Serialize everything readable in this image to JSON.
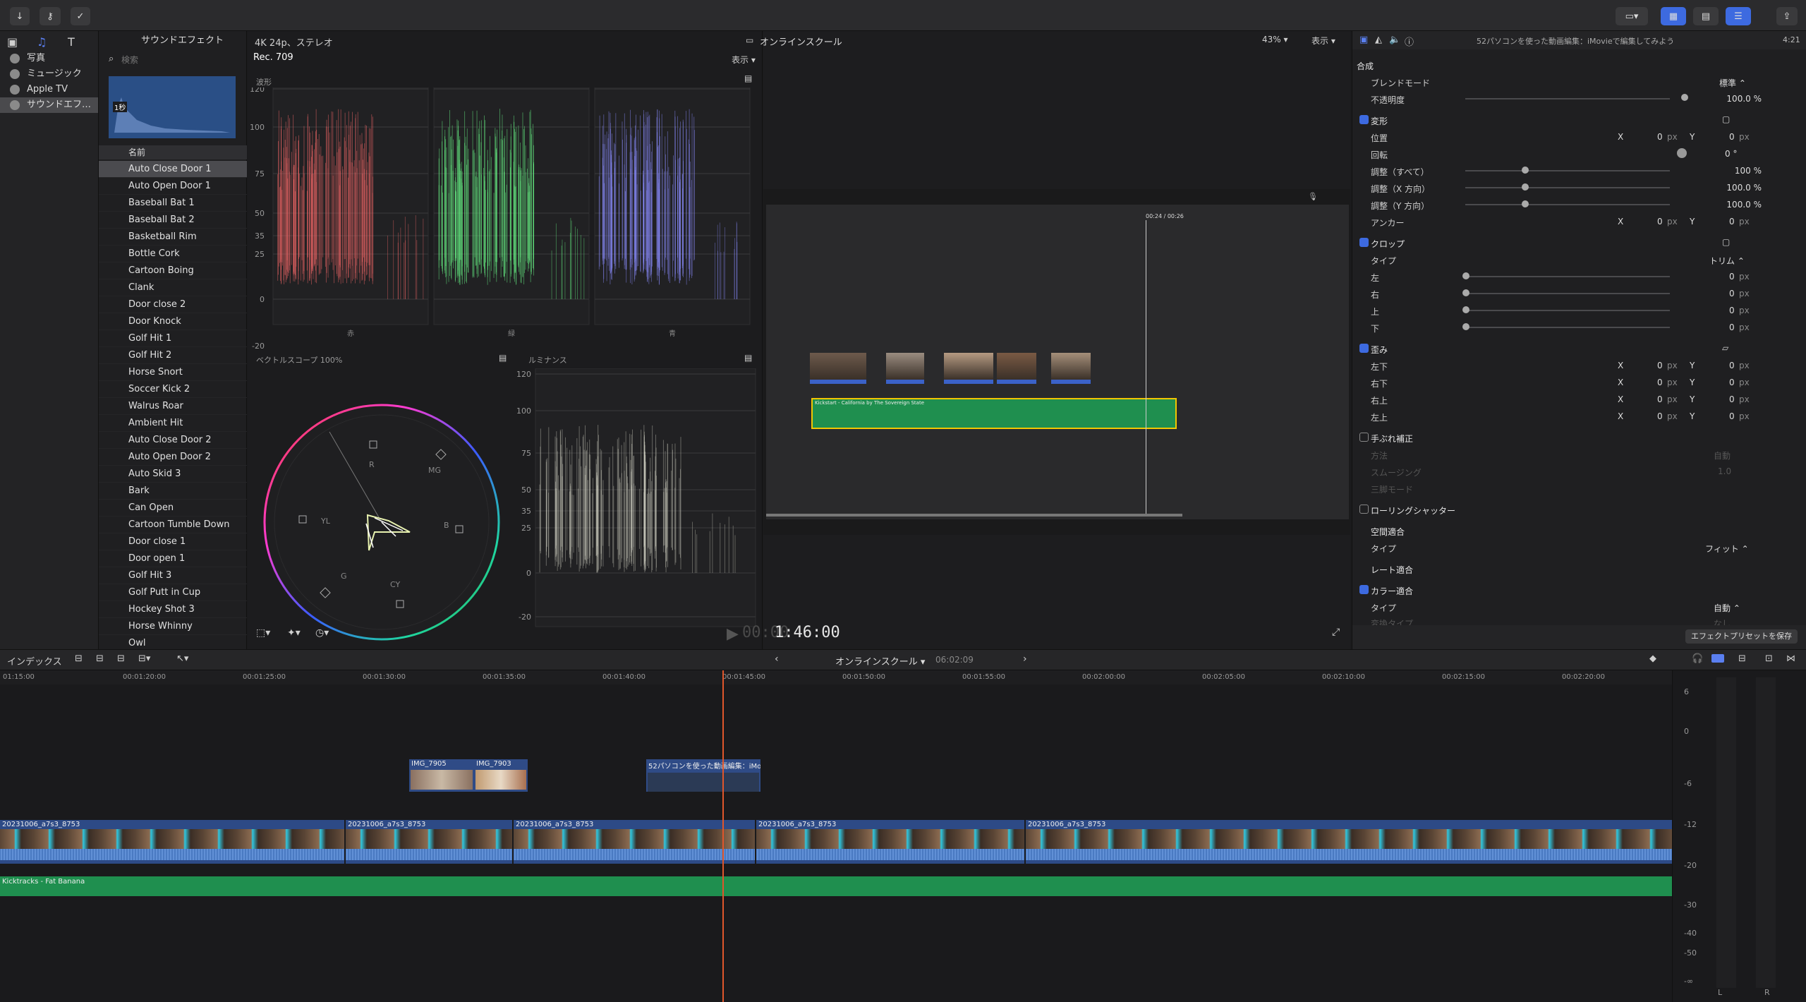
{
  "toolbar": {
    "share_icon": "share-icon"
  },
  "library": {
    "items": [
      {
        "label": "写真",
        "icon": "photos-icon"
      },
      {
        "label": "ミュージック",
        "icon": "music-icon"
      },
      {
        "label": "Apple TV",
        "icon": "tv-icon"
      },
      {
        "label": "サウンドエフ…",
        "icon": "sound-effects-icon"
      }
    ]
  },
  "browser": {
    "title": "サウンドエフェクト",
    "search_placeholder": "検索",
    "thumb_duration": "1秒",
    "column_name": "名前",
    "rows": [
      "Auto Close Door 1",
      "Auto Open Door 1",
      "Baseball Bat 1",
      "Baseball Bat 2",
      "Basketball Rim",
      "Bottle Cork",
      "Cartoon Boing",
      "Clank",
      "Door close 2",
      "Door Knock",
      "Golf Hit 1",
      "Golf Hit 2",
      "Horse Snort",
      "Soccer Kick 2",
      "Walrus Roar",
      "Ambient Hit",
      "Auto Close Door 2",
      "Auto Open Door 2",
      "Auto Skid 3",
      "Bark",
      "Can Open",
      "Cartoon Tumble Down",
      "Door close 1",
      "Door open 1",
      "Golf Hit 3",
      "Golf Putt in Cup",
      "Hockey Shot 3",
      "Horse Whinny",
      "Owl"
    ]
  },
  "scopes": {
    "format": "4K 24p、ステレオ",
    "color_space": "Rec. 709",
    "view_label": "表示",
    "waveform_label": "波形",
    "waveform_axis": [
      "120",
      "100",
      "75",
      "50",
      "35",
      "25",
      "0",
      "-20"
    ],
    "waveform_channels": [
      "赤",
      "緑",
      "青"
    ],
    "vectorscope_label": "ベクトルスコープ 100%",
    "vector_targets": [
      "R",
      "MG",
      "B",
      "CY",
      "G",
      "YL"
    ],
    "luma_label": "ルミナンス",
    "luma_axis": [
      "120",
      "100",
      "75",
      "50",
      "35",
      "25",
      "0",
      "-20"
    ],
    "timecode_prefix": "00:00",
    "timecode": "1:46:00"
  },
  "viewer": {
    "title": "オンラインスクール",
    "zoom": "43%",
    "view_label": "表示",
    "mini_timecode": "00:24 / 00:26",
    "music_label": "Kickstart - California by The Sovereign State"
  },
  "inspector": {
    "title": "52パソコンを使った動画編集：iMovieで編集してみよう",
    "duration": "4:21",
    "sections": {
      "composite": "合成",
      "blend_mode_label": "ブレンドモード",
      "blend_mode_value": "標準",
      "opacity_label": "不透明度",
      "opacity_value": "100.0 %",
      "transform": "変形",
      "position_label": "位置",
      "rotation_label": "回転",
      "scale_all_label": "調整（すべて）",
      "scale_all_value": "100 %",
      "scale_x_label": "調整（X 方向）",
      "scale_x_value": "100.0 %",
      "scale_y_label": "調整（Y 方向）",
      "scale_y_value": "100.0 %",
      "anchor_label": "アンカー",
      "crop": "クロップ",
      "crop_type_label": "タイプ",
      "crop_type_value": "トリム",
      "left_label": "左",
      "right_label": "右",
      "top_label": "上",
      "bottom_label": "下",
      "distort": "歪み",
      "bl_label": "左下",
      "br_label": "右下",
      "tr_label": "右上",
      "tl_label": "左上",
      "stabilization": "手ぶれ補正",
      "stab_method": "方法",
      "stab_method_value": "自動",
      "stab_smoothing": "スムージング",
      "stab_smoothing_value": "1.0",
      "stab_tripod": "三脚モード",
      "rolling_shutter": "ローリングシャッター",
      "spatial_conform": "空間適合",
      "spatial_type_label": "タイプ",
      "spatial_type_value": "フィット",
      "rate_conform": "レート適合",
      "color_conform": "カラー適合",
      "color_type_label": "タイプ",
      "color_type_value": "自動",
      "color_sub_label": "変換タイプ",
      "color_sub_value": "なし"
    },
    "px": "px",
    "zero": "0",
    "deg": "0 °",
    "x": "X",
    "y": "Y",
    "save_preset": "エフェクトプリセットを保存"
  },
  "timeline": {
    "index_label": "インデックス",
    "project_name": "オンラインスクール",
    "project_duration": "06:02:09",
    "ruler": [
      "01:15:00",
      "00:01:20:00",
      "00:01:25:00",
      "00:01:30:00",
      "00:01:35:00",
      "00:01:40:00",
      "00:01:45:00",
      "00:01:50:00",
      "00:01:55:00",
      "00:02:00:00",
      "00:02:05:00",
      "00:02:10:00",
      "00:02:15:00",
      "00:02:20:00"
    ],
    "connected_clips": [
      "IMG_7905",
      "IMG_7903",
      "52パソコンを使った動画編集：iMo..."
    ],
    "primary_clips": [
      "20231006_a7s3_8753",
      "20231006_a7s3_8753",
      "20231006_a7s3_8753",
      "20231006_a7s3_8753",
      "20231006_a7s3_8753"
    ],
    "music_clip": "Kicktracks - Fat Banana"
  },
  "meters": {
    "scale": [
      "6",
      "0",
      "-6",
      "-12",
      "-20",
      "-30",
      "-40",
      "-50",
      "-∞"
    ],
    "left": "L",
    "right": "R"
  },
  "colors": {
    "accent": "#3d6ae0",
    "video_clip": "#3b4f8c",
    "audio_clip": "#1f8f4f",
    "playhead": "#e0562b"
  }
}
